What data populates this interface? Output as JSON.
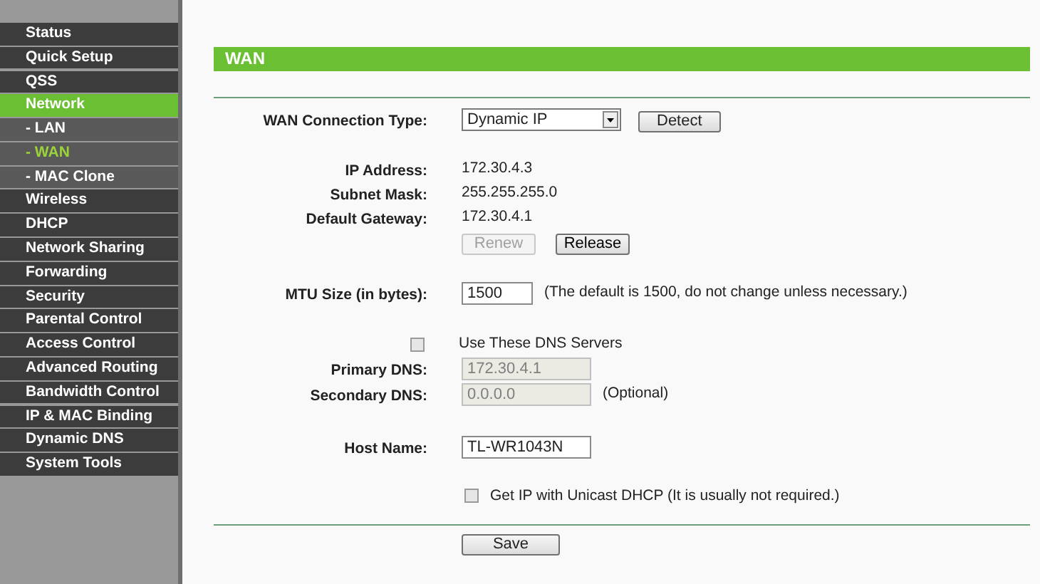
{
  "sidebar": {
    "items": [
      {
        "label": "Status",
        "selected": false
      },
      {
        "label": "Quick Setup",
        "selected": false
      },
      {
        "label": "QSS",
        "selected": false
      },
      {
        "label": "Network",
        "selected": true,
        "children": [
          {
            "label": "- LAN",
            "selected": false
          },
          {
            "label": "- WAN",
            "selected": true
          },
          {
            "label": "- MAC Clone",
            "selected": false
          }
        ]
      },
      {
        "label": "Wireless",
        "selected": false
      },
      {
        "label": "DHCP",
        "selected": false
      },
      {
        "label": "Network Sharing",
        "selected": false
      },
      {
        "label": "Forwarding",
        "selected": false
      },
      {
        "label": "Security",
        "selected": false
      },
      {
        "label": "Parental Control",
        "selected": false
      },
      {
        "label": "Access Control",
        "selected": false
      },
      {
        "label": "Advanced Routing",
        "selected": false
      },
      {
        "label": "Bandwidth Control",
        "selected": false
      },
      {
        "label": "IP & MAC Binding",
        "selected": false
      },
      {
        "label": "Dynamic DNS",
        "selected": false
      },
      {
        "label": "System Tools",
        "selected": false
      }
    ]
  },
  "page": {
    "title": "WAN",
    "connection_type": {
      "label": "WAN Connection Type:",
      "value": "Dynamic IP",
      "button": "Detect"
    },
    "info": [
      {
        "label": "IP Address:",
        "value": "172.30.4.3"
      },
      {
        "label": "Subnet Mask:",
        "value": "255.255.255.0"
      },
      {
        "label": "Default Gateway:",
        "value": "172.30.4.1"
      }
    ],
    "buttons": [
      {
        "label": "Renew",
        "disabled": true
      },
      {
        "label": "Release",
        "disabled": false
      }
    ],
    "mtu": {
      "label": "MTU Size (in bytes):",
      "value": "1500",
      "note": "(The default is 1500, do not change unless necessary.)"
    },
    "dns": {
      "label": "Use These DNS Servers",
      "checked": false,
      "fields": [
        {
          "label": "Primary DNS:",
          "value": "172.30.4.1",
          "disabled": true
        },
        {
          "label": "Secondary DNS:",
          "value": "0.0.0.0",
          "disabled": true,
          "note": "(Optional)"
        }
      ]
    },
    "host": {
      "label": "Host Name:",
      "value": "TL-WR1043N"
    },
    "unicast": {
      "label": "Get IP with Unicast DHCP (It is usually not required.)",
      "checked": false
    },
    "save": "Save"
  }
}
